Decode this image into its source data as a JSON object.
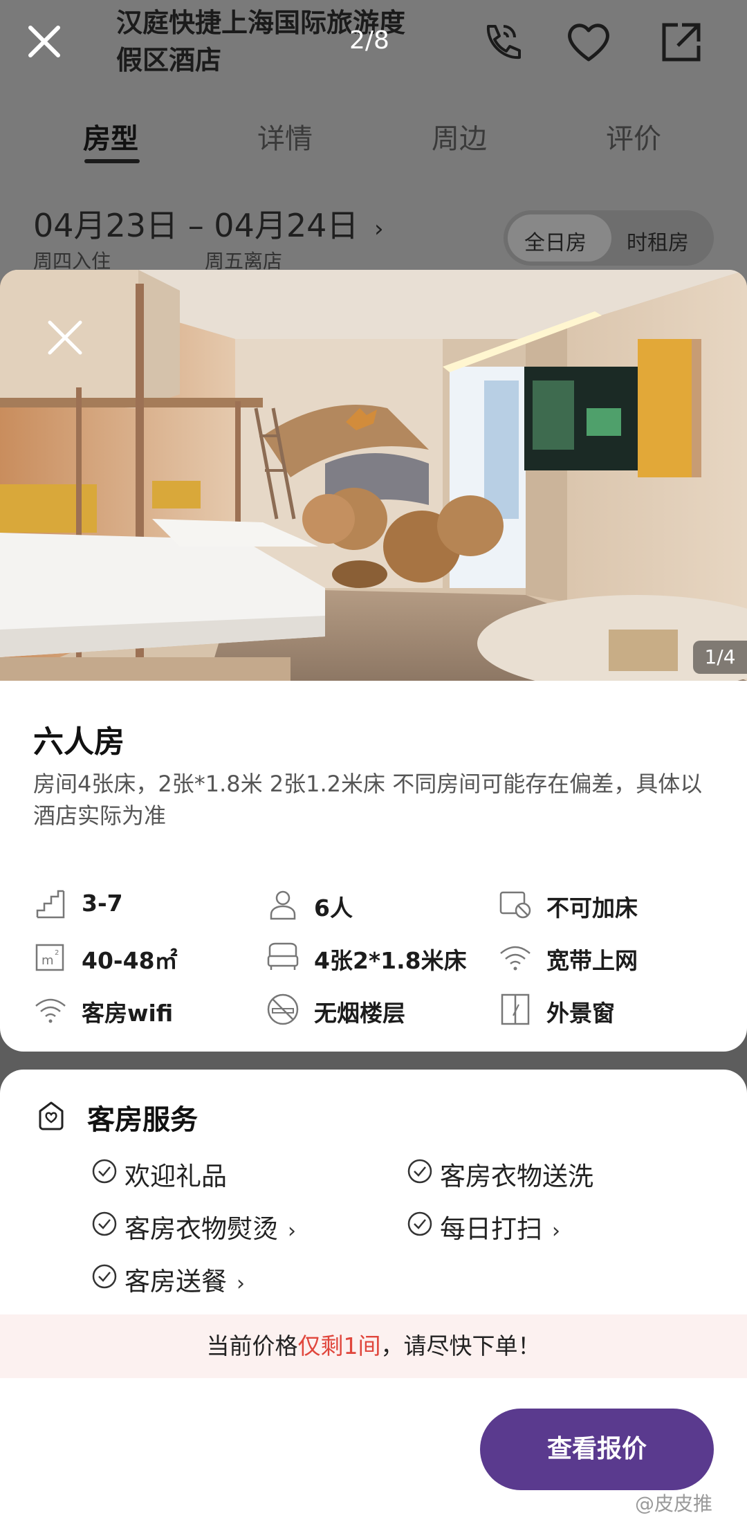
{
  "header": {
    "title": "汉庭快捷上海国际旅游度假区酒店",
    "title_line1": "汉庭快捷上海国际旅游度",
    "title_line2": "假区酒店",
    "gallery_counter": "2/8",
    "icons": [
      "close-icon",
      "phone-icon",
      "heart-icon",
      "share-icon"
    ]
  },
  "tabs": [
    {
      "label": "房型",
      "active": true
    },
    {
      "label": "详情",
      "active": false
    },
    {
      "label": "周边",
      "active": false
    },
    {
      "label": "评价",
      "active": false
    }
  ],
  "dates": {
    "range": "04月23日 – 04月24日",
    "checkin_label": "周四入住",
    "checkout_label": "周五离店",
    "chevron": "›"
  },
  "booking_type": {
    "options": [
      "全日房",
      "时租房"
    ],
    "selected": "全日房"
  },
  "photo": {
    "counter": "1/4"
  },
  "room": {
    "name": "六人房",
    "description": "房间4张床，2张*1.8米 2张1.2米床 不同房间可能存在偏差，具体以酒店实际为准",
    "amenities": [
      {
        "icon": "floor-icon",
        "text": "3-7"
      },
      {
        "icon": "person-icon",
        "text": "6人"
      },
      {
        "icon": "no-extra-bed-icon",
        "text": "不可加床"
      },
      {
        "icon": "area-icon",
        "text": "40-48㎡"
      },
      {
        "icon": "bed-icon",
        "text": "4张2*1.8米床"
      },
      {
        "icon": "wifi-icon",
        "text": "宽带上网"
      },
      {
        "icon": "wifi-icon",
        "text": "客房wifi"
      },
      {
        "icon": "no-smoking-icon",
        "text": "无烟楼层"
      },
      {
        "icon": "window-icon",
        "text": "外景窗"
      }
    ]
  },
  "services": {
    "title": "客房服务",
    "items": [
      {
        "text": "欢迎礼品",
        "has_arrow": false
      },
      {
        "text": "客房衣物送洗",
        "has_arrow": false
      },
      {
        "text": "客房衣物熨烫",
        "has_arrow": true
      },
      {
        "text": "每日打扫",
        "has_arrow": true
      },
      {
        "text": "客房送餐",
        "has_arrow": true
      }
    ]
  },
  "notice": {
    "prefix": "当前价格",
    "highlight": "仅剩1间",
    "suffix": "，请尽快下单！"
  },
  "cta": {
    "label": "查看报价"
  },
  "watermark": "@皮皮推",
  "colors": {
    "accent": "#5a3a8e",
    "urgent": "#e0463c",
    "banner_bg": "#fcf1f0"
  }
}
